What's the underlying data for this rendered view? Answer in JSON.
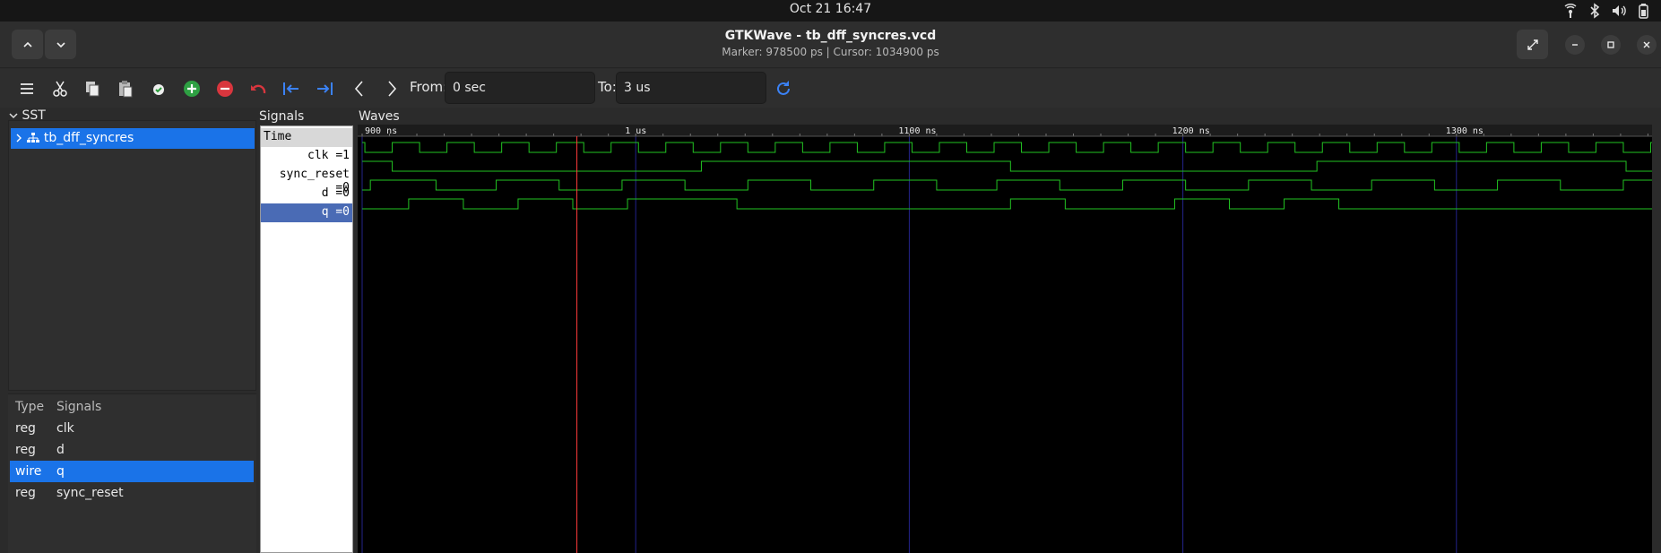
{
  "system": {
    "clock": "Oct 21  16:47"
  },
  "window": {
    "title": "GTKWave - tb_dff_syncres.vcd",
    "subtitle": "Marker: 978500 ps  |  Cursor: 1034900 ps"
  },
  "toolbar": {
    "from_label": "From:",
    "from_value": "0 sec",
    "to_label": "To:",
    "to_value": "3 us"
  },
  "sst": {
    "title": "SST",
    "tree_item": "tb_dff_syncres",
    "list_header_type": "Type",
    "list_header_signals": "Signals",
    "signals": [
      {
        "type": "reg",
        "name": "clk"
      },
      {
        "type": "reg",
        "name": "d"
      },
      {
        "type": "wire",
        "name": "q"
      },
      {
        "type": "reg",
        "name": "sync_reset"
      }
    ]
  },
  "signals_pane": {
    "title": "Signals",
    "time_label": "Time",
    "rows": [
      "clk =1",
      "sync_reset =0",
      "d =0",
      "q =0"
    ]
  },
  "waves": {
    "title": "Waves",
    "time_labels": [
      "900 ns",
      "1 us",
      "1100 ns",
      "1200 ns",
      "1300 ns"
    ],
    "marker_time_ps": 978500,
    "cursor_time_ps": 1034900,
    "clk_period_ns": 20,
    "traces": {
      "clk": [
        [
          900,
          1
        ],
        [
          901,
          0
        ],
        [
          911,
          1
        ],
        [
          921,
          0
        ],
        [
          931,
          1
        ],
        [
          941,
          0
        ],
        [
          951,
          1
        ],
        [
          961,
          0
        ],
        [
          971,
          1
        ],
        [
          981,
          0
        ],
        [
          991,
          1
        ],
        [
          1001,
          0
        ],
        [
          1011,
          1
        ],
        [
          1021,
          0
        ],
        [
          1031,
          1
        ],
        [
          1041,
          0
        ],
        [
          1051,
          1
        ],
        [
          1061,
          0
        ],
        [
          1071,
          1
        ],
        [
          1081,
          0
        ],
        [
          1091,
          1
        ],
        [
          1101,
          0
        ],
        [
          1111,
          1
        ],
        [
          1121,
          0
        ],
        [
          1131,
          1
        ],
        [
          1141,
          0
        ],
        [
          1151,
          1
        ],
        [
          1161,
          0
        ],
        [
          1171,
          1
        ],
        [
          1181,
          0
        ],
        [
          1191,
          1
        ],
        [
          1201,
          0
        ],
        [
          1211,
          1
        ],
        [
          1221,
          0
        ],
        [
          1231,
          1
        ],
        [
          1241,
          0
        ],
        [
          1251,
          1
        ],
        [
          1261,
          0
        ],
        [
          1271,
          1
        ],
        [
          1281,
          0
        ],
        [
          1291,
          1
        ],
        [
          1301,
          0
        ],
        [
          1311,
          1
        ],
        [
          1321,
          0
        ],
        [
          1331,
          1
        ],
        [
          1341,
          0
        ],
        [
          1351,
          1
        ],
        [
          1361,
          0
        ],
        [
          1371,
          1
        ]
      ],
      "sync_reset": [
        [
          900,
          1
        ],
        [
          911,
          0
        ],
        [
          1024,
          1
        ],
        [
          1137,
          0
        ],
        [
          1249,
          1
        ],
        [
          1362,
          0
        ]
      ],
      "d": [
        [
          900,
          0
        ],
        [
          903,
          1
        ],
        [
          927,
          0
        ],
        [
          949,
          1
        ],
        [
          972,
          0
        ],
        [
          995,
          1
        ],
        [
          1018,
          0
        ],
        [
          1041,
          1
        ],
        [
          1064,
          0
        ],
        [
          1087,
          1
        ],
        [
          1110,
          0
        ],
        [
          1132,
          1
        ],
        [
          1155,
          0
        ],
        [
          1178,
          1
        ],
        [
          1201,
          0
        ],
        [
          1224,
          1
        ],
        [
          1247,
          0
        ],
        [
          1269,
          1
        ],
        [
          1292,
          0
        ],
        [
          1315,
          1
        ],
        [
          1338,
          0
        ],
        [
          1361,
          1
        ]
      ],
      "q": [
        [
          900,
          0
        ],
        [
          917,
          1
        ],
        [
          937,
          0
        ],
        [
          957,
          1
        ],
        [
          977,
          0
        ],
        [
          997,
          1
        ],
        [
          1037,
          0
        ],
        [
          1137,
          1
        ],
        [
          1157,
          0
        ],
        [
          1197,
          1
        ],
        [
          1217,
          0
        ],
        [
          1237,
          1
        ],
        [
          1257,
          0
        ]
      ]
    }
  }
}
